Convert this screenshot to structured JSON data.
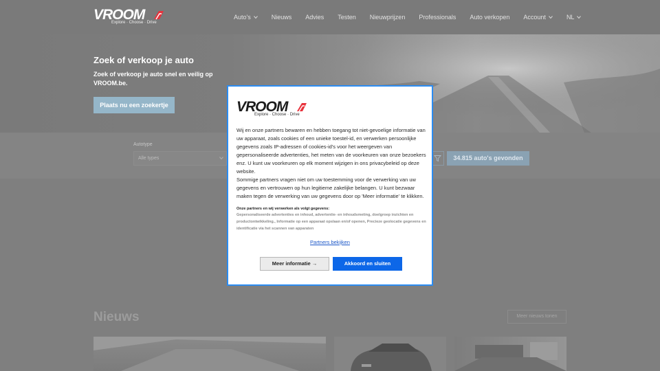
{
  "brand": {
    "name": "VROOM",
    "tagline": "Explore · Choose · Drive",
    "accent_color": "#e8323c"
  },
  "nav": {
    "items": [
      {
        "label": "Auto's",
        "has_dropdown": true
      },
      {
        "label": "Nieuws",
        "has_dropdown": false
      },
      {
        "label": "Advies",
        "has_dropdown": false
      },
      {
        "label": "Testen",
        "has_dropdown": false
      },
      {
        "label": "Nieuwprijzen",
        "has_dropdown": false
      },
      {
        "label": "Professionals",
        "has_dropdown": false
      },
      {
        "label": "Auto verkopen",
        "has_dropdown": false
      },
      {
        "label": "Account",
        "has_dropdown": true
      },
      {
        "label": "NL",
        "has_dropdown": true
      }
    ]
  },
  "hero": {
    "title": "Zoek of verkoop je auto",
    "subtitle": "Zoek of verkoop je auto snel en veilig op VROOM.be.",
    "cta_label": "Plaats nu een zoekertje"
  },
  "search": {
    "type_label": "Autotype",
    "type_value": "Alle types",
    "results_label": "34.815 auto's gevonden"
  },
  "news": {
    "heading": "Nieuws",
    "more_label": "Meer nieuws tonen"
  },
  "consent": {
    "body": "Wij en onze partners bewaren en hebben toegang tot niet-gevoelige informatie van uw apparaat, zoals cookies of een unieke toestel-id, en verwerken persoonlijke gegevens zoals IP-adressen of cookies-id's voor het weergeven van gepersonaliseerde advertenties, het meten van de voorkeuren van onze bezoekers enz. U kunt uw voorkeuren op elk moment wijzigen in ons privacybeleid op deze website.",
    "body2": "Sommige partners vragen niet om uw toestemming voor de verwerking van uw gegevens en vertrouwen op hun legitieme zakelijke belangen. U kunt bezwaar maken tegen de verwerking van uw gegevens door op 'Meer informatie' te klikken.",
    "purposes_heading": "Onze partners en wij verwerken als volgt gegevens:",
    "purposes": "Gepersonaliseerde advertenties en inhoud, advertentie- en inhoudsmeting, doelgroep inzichten en productontwikkeling., Informatie op een apparaat opslaan en/of openen, Precieze geolocatie gegevens en identificatie via het scannen van apparaten",
    "partners_link": "Partners bekijken",
    "more_label": "Meer informatie →",
    "accept_label": "Akkoord en sluiten",
    "border_color": "#2b8cf3",
    "accept_color": "#0d67e8"
  }
}
